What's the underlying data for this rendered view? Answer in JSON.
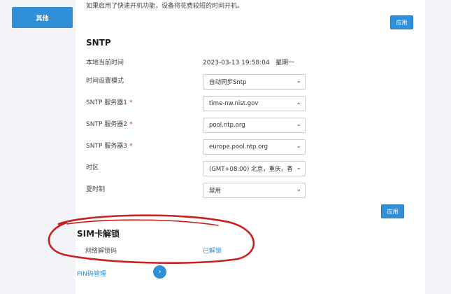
{
  "sidebar": {
    "active_item": "其他"
  },
  "fast_boot": {
    "description": "如果启用了快速开机功能，设备将花费较短的时间开机。",
    "apply_label": "应用"
  },
  "sntp": {
    "title": "SNTP",
    "local_time_label": "本地当前时间",
    "local_time_value": "2023-03-13 19:58:04   星期一",
    "mode_label": "时间设置模式",
    "mode_value": "自动同步Sntp",
    "server1_label": "SNTP 服务器1",
    "server1_value": "time-nw.nist.gov",
    "server2_label": "SNTP 服务器2",
    "server2_value": "pool.ntp.org",
    "server3_label": "SNTP 服务器3",
    "server3_value": "europe.pool.ntp.org",
    "timezone_label": "时区",
    "timezone_value": "(GMT+08:00) 北京，重庆，香",
    "dst_label": "夏时制",
    "dst_value": "禁用",
    "required_mark": "*",
    "apply_label": "应用"
  },
  "sim": {
    "title": "SIM卡解锁",
    "unlock_code_label": "网络解锁码",
    "unlock_status": "已解锁",
    "pin_label": "PIN码管理"
  },
  "colors": {
    "accent": "#2f8fd8",
    "annotation": "#c8201e"
  }
}
